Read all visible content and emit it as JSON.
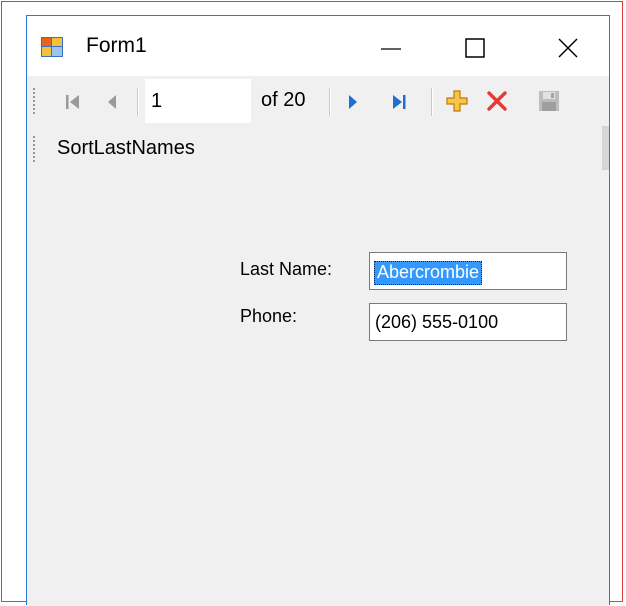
{
  "window": {
    "title": "Form1"
  },
  "navigator": {
    "position_value": "1",
    "count_text": "of 20"
  },
  "menu": {
    "items": [
      {
        "label": "SortLastNames"
      }
    ]
  },
  "form": {
    "last_name_label": "Last Name:",
    "last_name_value": "Abercrombie",
    "phone_label": "Phone:",
    "phone_value": "(206) 555-0100"
  },
  "colors": {
    "accent_blue": "#2b78d6",
    "selection": "#3399ff",
    "delete_red": "#e53935",
    "add_orange": "#f0a30a"
  },
  "icons": [
    "app-form-icon",
    "minimize-icon",
    "maximize-icon",
    "close-icon",
    "move-first-icon",
    "move-previous-icon",
    "move-next-icon",
    "move-last-icon",
    "add-new-icon",
    "delete-icon",
    "save-icon"
  ]
}
